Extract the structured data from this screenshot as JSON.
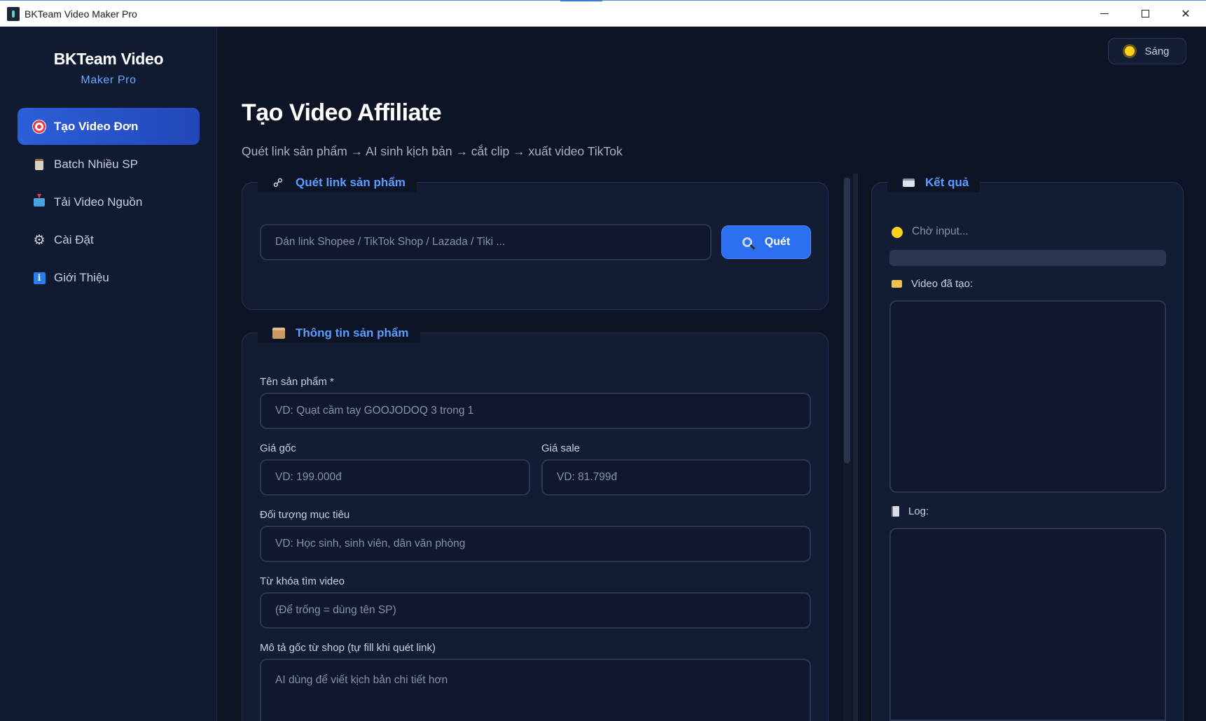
{
  "window": {
    "title": "BKTeam Video Maker Pro",
    "minimize_icon": "minimize-icon",
    "maximize_icon": "maximize-icon",
    "close_glyph": "✕"
  },
  "sidebar": {
    "brand_title": "BKTeam Video",
    "brand_subtitle": "Maker Pro",
    "items": [
      {
        "label": "Tạo Video Đơn",
        "icon": "target-icon",
        "active": true
      },
      {
        "label": "Batch Nhiều SP",
        "icon": "clipboard-icon",
        "active": false
      },
      {
        "label": "Tải Video Nguồn",
        "icon": "download-icon",
        "active": false
      },
      {
        "label": "Cài Đặt",
        "icon": "gear-icon",
        "active": false
      },
      {
        "label": "Giới Thiệu",
        "icon": "info-icon",
        "active": false
      }
    ]
  },
  "theme_toggle": {
    "label": "Sáng",
    "icon": "sun-icon"
  },
  "header": {
    "title": "Tạo Video Affiliate",
    "subtitle": "Quét link sản phẩm → AI sinh kịch bản → cắt clip → xuất video TikTok"
  },
  "scan_panel": {
    "legend": "Quét link sản phẩm",
    "icon": "link-icon",
    "url_placeholder": "Dán link Shopee / TikTok Shop / Lazada / Tiki ...",
    "scan_button": "Quét",
    "scan_icon": "magnifier-icon"
  },
  "product_panel": {
    "legend": "Thông tin sản phẩm",
    "icon": "package-icon",
    "name_label": "Tên sản phẩm *",
    "name_placeholder": "VD: Quạt cầm tay GOOJODOQ 3 trong 1",
    "price_label": "Giá gốc",
    "price_placeholder": "VD: 199.000đ",
    "sale_label": "Giá sale",
    "sale_placeholder": "VD: 81.799đ",
    "audience_label": "Đối tượng mục tiêu",
    "audience_placeholder": "VD: Học sinh, sinh viên, dân văn phòng",
    "keyword_label": "Từ khóa tìm video",
    "keyword_placeholder": "(Để trống = dùng tên SP)",
    "desc_label": "Mô tả gốc từ shop (tự fill khi quét link)",
    "desc_placeholder": "AI dùng để viết kịch bản chi tiết hơn"
  },
  "result_panel": {
    "legend": "Kết quả",
    "icon": "card-icon",
    "status_text": "Chờ input...",
    "status_color": "#ffd21a",
    "progress": 0,
    "videos_label": "Video đã tạo:",
    "videos_icon": "folder-icon",
    "log_label": "Log:",
    "log_icon": "log-icon"
  },
  "colors": {
    "background": "#0d1426",
    "accent": "#2b6ef0",
    "legend_text": "#5b9dff"
  }
}
